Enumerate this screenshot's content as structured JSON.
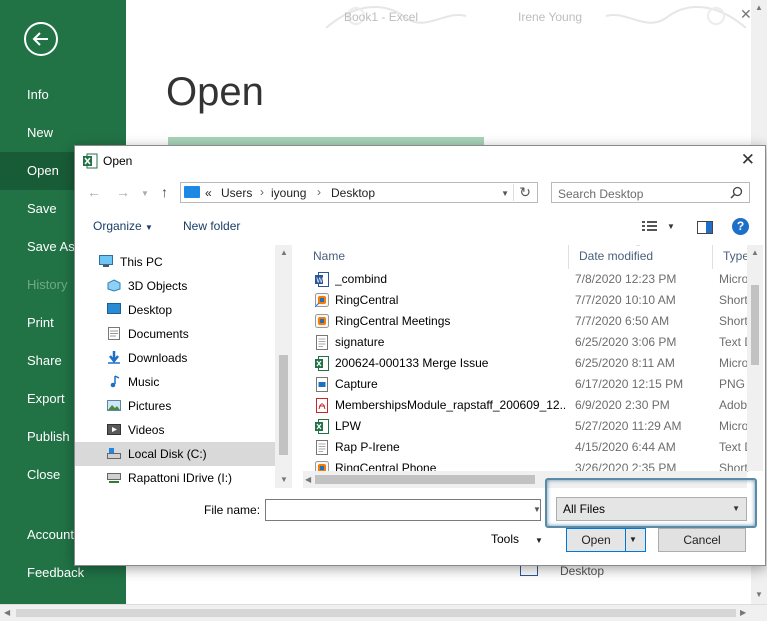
{
  "app": {
    "window_title": "Book1  -  Excel",
    "user_name": "Irene Young",
    "page_title": "Open"
  },
  "sidebar": {
    "items": [
      {
        "label": "Info"
      },
      {
        "label": "New"
      },
      {
        "label": "Open"
      },
      {
        "label": "Save"
      },
      {
        "label": "Save As"
      },
      {
        "label": "History"
      },
      {
        "label": "Print"
      },
      {
        "label": "Share"
      },
      {
        "label": "Export"
      },
      {
        "label": "Publish"
      },
      {
        "label": "Close"
      },
      {
        "label": "Account"
      },
      {
        "label": "Feedback"
      }
    ]
  },
  "background": {
    "recent_item": "Desktop"
  },
  "dialog": {
    "title": "Open",
    "address": {
      "overflow": "«",
      "segments": [
        "Users",
        "iyoung",
        "Desktop"
      ]
    },
    "search_placeholder": "Search Desktop",
    "toolbar": {
      "organize": "Organize",
      "new_folder": "New folder"
    },
    "nav": [
      {
        "label": "This PC"
      },
      {
        "label": "3D Objects"
      },
      {
        "label": "Desktop"
      },
      {
        "label": "Documents"
      },
      {
        "label": "Downloads"
      },
      {
        "label": "Music"
      },
      {
        "label": "Pictures"
      },
      {
        "label": "Videos"
      },
      {
        "label": "Local Disk (C:)"
      },
      {
        "label": "Rapattoni IDrive (I:)"
      }
    ],
    "columns": {
      "name": "Name",
      "date": "Date modified",
      "type": "Type"
    },
    "files": [
      {
        "name": "_combind",
        "date": "7/8/2020 12:23 PM",
        "type": "Micro"
      },
      {
        "name": "RingCentral",
        "date": "7/7/2020 10:10 AM",
        "type": "Short"
      },
      {
        "name": "RingCentral Meetings",
        "date": "7/7/2020 6:50 AM",
        "type": "Short"
      },
      {
        "name": "signature",
        "date": "6/25/2020 3:06 PM",
        "type": "Text D"
      },
      {
        "name": "200624-000133 Merge Issue",
        "date": "6/25/2020 8:11 AM",
        "type": "Micro"
      },
      {
        "name": "Capture",
        "date": "6/17/2020 12:15 PM",
        "type": "PNG"
      },
      {
        "name": "MembershipsModule_rapstaff_200609_12...",
        "date": "6/9/2020 2:30 PM",
        "type": "Adob"
      },
      {
        "name": "LPW",
        "date": "5/27/2020 11:29 AM",
        "type": "Micro"
      },
      {
        "name": "Rap P-Irene",
        "date": "4/15/2020 6:44 AM",
        "type": "Text D"
      },
      {
        "name": "RingCentral Phone",
        "date": "3/26/2020 2:35 PM",
        "type": "Short"
      }
    ],
    "file_name_label": "File name:",
    "file_name_value": "",
    "file_type_value": "All Files",
    "tools": "Tools",
    "open_button": "Open",
    "cancel_button": "Cancel"
  },
  "colors": {
    "excel_green": "#217346",
    "active_green": "#185c37",
    "accent_blue": "#0078d7"
  }
}
